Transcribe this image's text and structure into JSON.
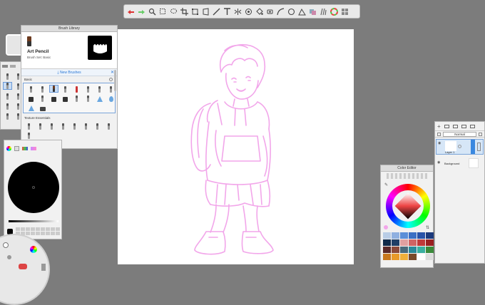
{
  "toolbar": {
    "icons": [
      "undo-icon",
      "redo-icon",
      "zoom-icon",
      "select-icon",
      "lasso-icon",
      "crop-icon",
      "transform-icon",
      "perspective-icon",
      "ruler-icon",
      "text-icon",
      "symmetry-icon",
      "stroke-icon",
      "fill-icon",
      "eyedropper-icon",
      "curve-icon",
      "ellipse-icon",
      "shape-icon",
      "layers-icon",
      "brush-icon",
      "color-icon",
      "grid-icon"
    ]
  },
  "brush_library": {
    "title": "Brush Library",
    "brush_name": "Art Pencil",
    "brush_set": "Brush Set: Basic",
    "new_brushes": "New Brushes",
    "section_basic": "Basic",
    "section_texture": "Texture Essentials"
  },
  "layers": {
    "blend_mode": "Normal",
    "layer1_name": "Layer 1",
    "background_name": "Background"
  },
  "color_editor": {
    "title": "Color Editor",
    "swatches": [
      "#b9cde6",
      "#8fb0e0",
      "#5b8fd8",
      "#3b6fc4",
      "#2852a8",
      "#1c3a7c",
      "#0f2a4a",
      "#1e3f66",
      "#e0a0a0",
      "#d06464",
      "#c03a3a",
      "#9a2020",
      "#5a2a2a",
      "#8a4a3a",
      "#4a6a7a",
      "#2a8a9a",
      "#3ab0a0",
      "#3a8a3a",
      "#c8781e",
      "#e89a2a",
      "#f0b03a",
      "#7a4a2a",
      "#ffffff",
      "#dcdcdc"
    ]
  },
  "colors": {
    "accent": "#2b78d6",
    "sketch": "#f2a6ea",
    "background": "#7c7c7c"
  }
}
